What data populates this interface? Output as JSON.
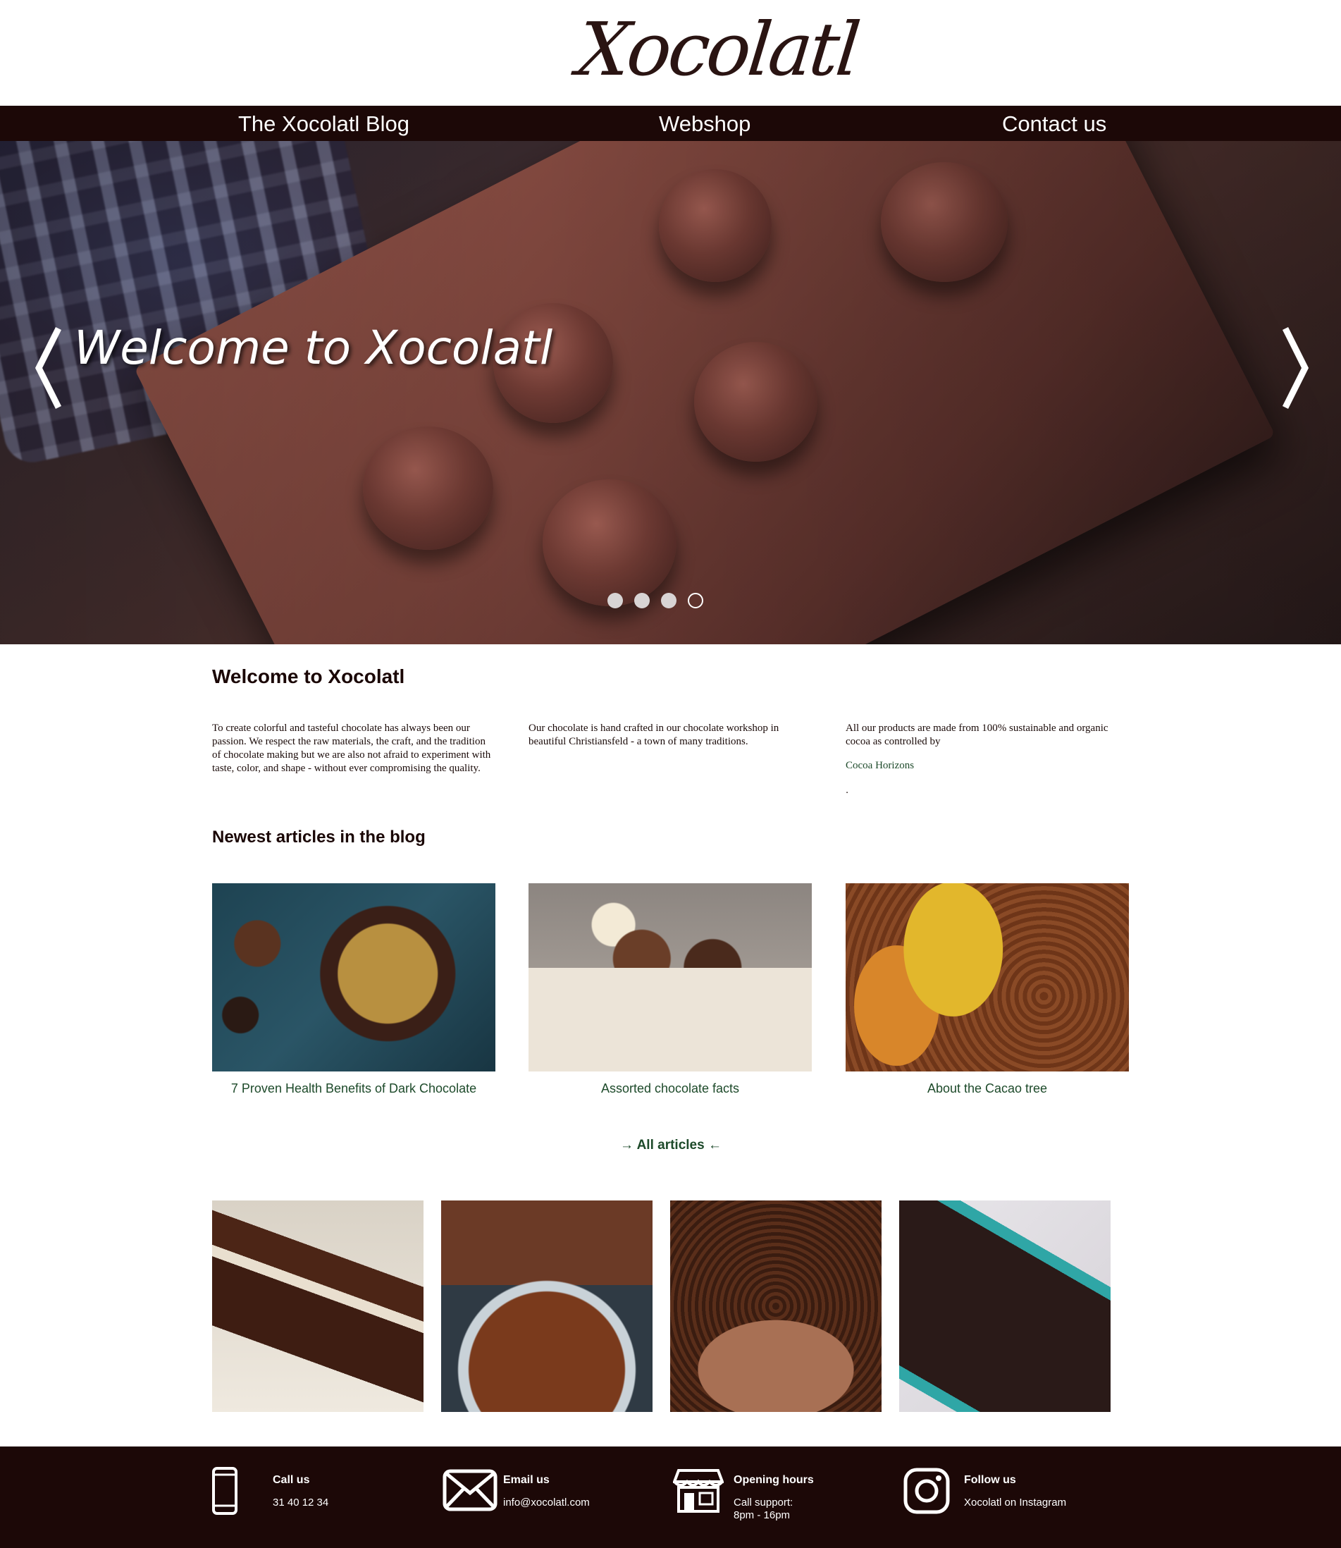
{
  "brand": {
    "logo_text": "Xocolatl"
  },
  "nav": {
    "items": [
      {
        "label": "The Xocolatl Blog"
      },
      {
        "label": "Webshop"
      },
      {
        "label": "Contact us"
      }
    ]
  },
  "hero": {
    "title": "Welcome to Xocolatl",
    "slides_total": 4,
    "active_slide": 4
  },
  "welcome": {
    "heading": "Welcome to Xocolatl",
    "col1": "To create colorful and tasteful chocolate has always been our passion. We respect the raw materials, the craft, and the tradition of chocolate making but we are also not afraid to experiment with taste, color, and shape - without ever compromising the quality.",
    "col2": "Our chocolate is hand crafted in our chocolate workshop in beautiful Christiansfeld - a town of many traditions.",
    "col3": "All our products are made from 100% sustainable and organic cocoa as controlled by",
    "link": "Cocoa Horizons",
    "trailing": "."
  },
  "blog": {
    "heading": "Newest articles in the blog",
    "articles": [
      {
        "title": "7 Proven Health Benefits of Dark Chocolate"
      },
      {
        "title": "Assorted chocolate facts"
      },
      {
        "title": "About the Cacao tree"
      }
    ],
    "all_articles": "→ All articles ←"
  },
  "footer": {
    "call": {
      "title": "Call us",
      "text": "31 40 12 34",
      "icon": "phone-icon"
    },
    "email": {
      "title": "Email us",
      "text": "info@xocolatl.com",
      "icon": "envelope-icon"
    },
    "hours": {
      "title": "Opening hours",
      "text": "Call support:",
      "text2": "8pm - 16pm",
      "icon": "shop-icon"
    },
    "follow": {
      "title": "Follow us",
      "text": "Xocolatl on Instagram",
      "icon": "instagram-icon"
    }
  },
  "colors": {
    "dark_brown": "#1c0807",
    "link_green": "#1d4a2a"
  }
}
